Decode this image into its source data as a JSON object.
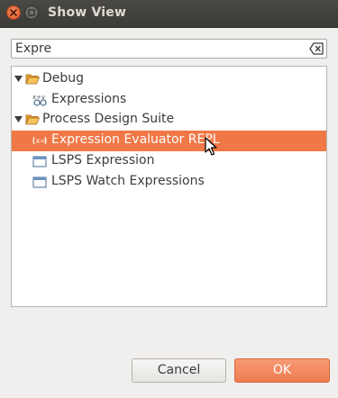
{
  "window": {
    "title": "Show View"
  },
  "search": {
    "value": "Expre"
  },
  "tree": {
    "items": [
      {
        "label": "Debug",
        "type": "category",
        "icon": "folder-open-icon"
      },
      {
        "label": "Expressions",
        "type": "view",
        "icon": "expressions-icon"
      },
      {
        "label": "Process Design Suite",
        "type": "category",
        "icon": "folder-open-icon"
      },
      {
        "label": "Expression Evaluator REPL",
        "type": "view",
        "icon": "repl-icon",
        "selected": true
      },
      {
        "label": "LSPS Expression",
        "type": "view",
        "icon": "view-window-icon"
      },
      {
        "label": "LSPS Watch Expressions",
        "type": "view",
        "icon": "view-window-icon"
      }
    ]
  },
  "buttons": {
    "cancel_label": "Cancel",
    "ok_label": "OK"
  },
  "colors": {
    "selection": "#f07746",
    "ok_button": "#ef7b4f",
    "titlebar": "#3c3b37"
  }
}
